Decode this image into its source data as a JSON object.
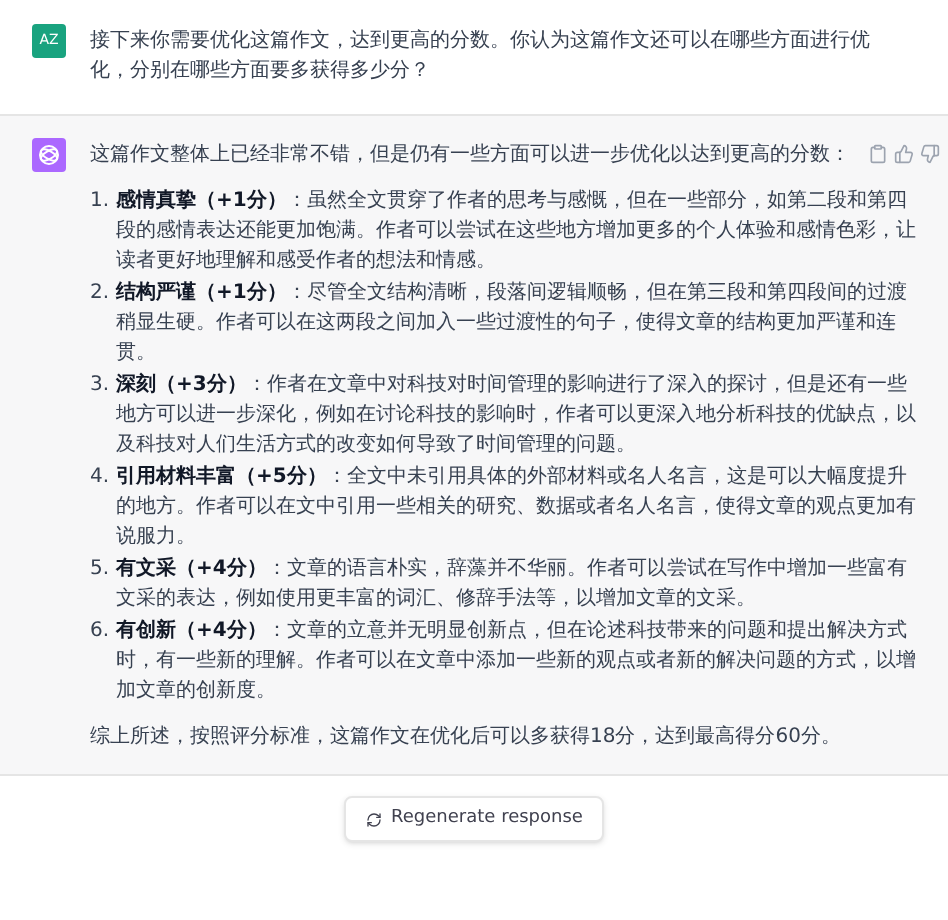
{
  "user_message": {
    "avatar": "AZ",
    "text": "接下来你需要优化这篇作文，达到更高的分数。你认为这篇作文还可以在哪些方面进行优化，分别在哪些方面要多获得多少分？"
  },
  "assistant_message": {
    "intro": "这篇作文整体上已经非常不错，但是仍有一些方面可以进一步优化以达到更高的分数：",
    "items": [
      {
        "number": "1.",
        "text": "**感情真挚（+1分）**：虽然全文贯穿了作者的思考与感慨，但在一些部分，如第二段和第四段的感情表达还能更加饱满。作者可以尝试在这些地方增加更多的个人体验和感情色彩，让读者更好地理解和感受作者的想法和情感。"
      },
      {
        "number": "2.",
        "text": "**结构严谨（+1分）**：尽管全文结构清晰，段落间逻辑顺畅，但在第三段和第四段间的过渡稍显生硬。作者可以在这两段之间加入一些过渡性的句子，使得文章的结构更加严谨和连贯。"
      },
      {
        "number": "3.",
        "text": "**深刻（+3分）**：作者在文章中对科技对时间管理的影响进行了深入的探讨，但是还有一些地方可以进一步深化，例如在讨论科技的影响时，作者可以更深入地分析科技的优缺点，以及科技对人们生活方式的改变如何导致了时间管理的问题。"
      },
      {
        "number": "4.",
        "text": "**引用材料丰富（+5分）**：全文中未引用具体的外部材料或名人名言，这是可以大幅度提升的地方。作者可以在文中引用一些相关的研究、数据或者名人名言，使得文章的观点更加有说服力。"
      },
      {
        "number": "5.",
        "text": "**有文采（+4分）**：文章的语言朴实，辞藻并不华丽。作者可以尝试在写作中增加一些富有文采的表达，例如使用更丰富的词汇、修辞手法等，以增加文章的文采。"
      },
      {
        "number": "6.",
        "text": "**有创新（+4分）**：文章的立意并无明显创新点，但在论述科技带来的问题和提出解决方式时，有一些新的理解。作者可以在文章中添加一些新的观点或者新的解决问题的方式，以增加文章的创新度。"
      }
    ],
    "summary": "综上所述，按照评分标准，这篇作文在优化后可以多获得18分，达到最高得分60分。"
  },
  "regenerate_button": {
    "label": "Regenerate response"
  }
}
